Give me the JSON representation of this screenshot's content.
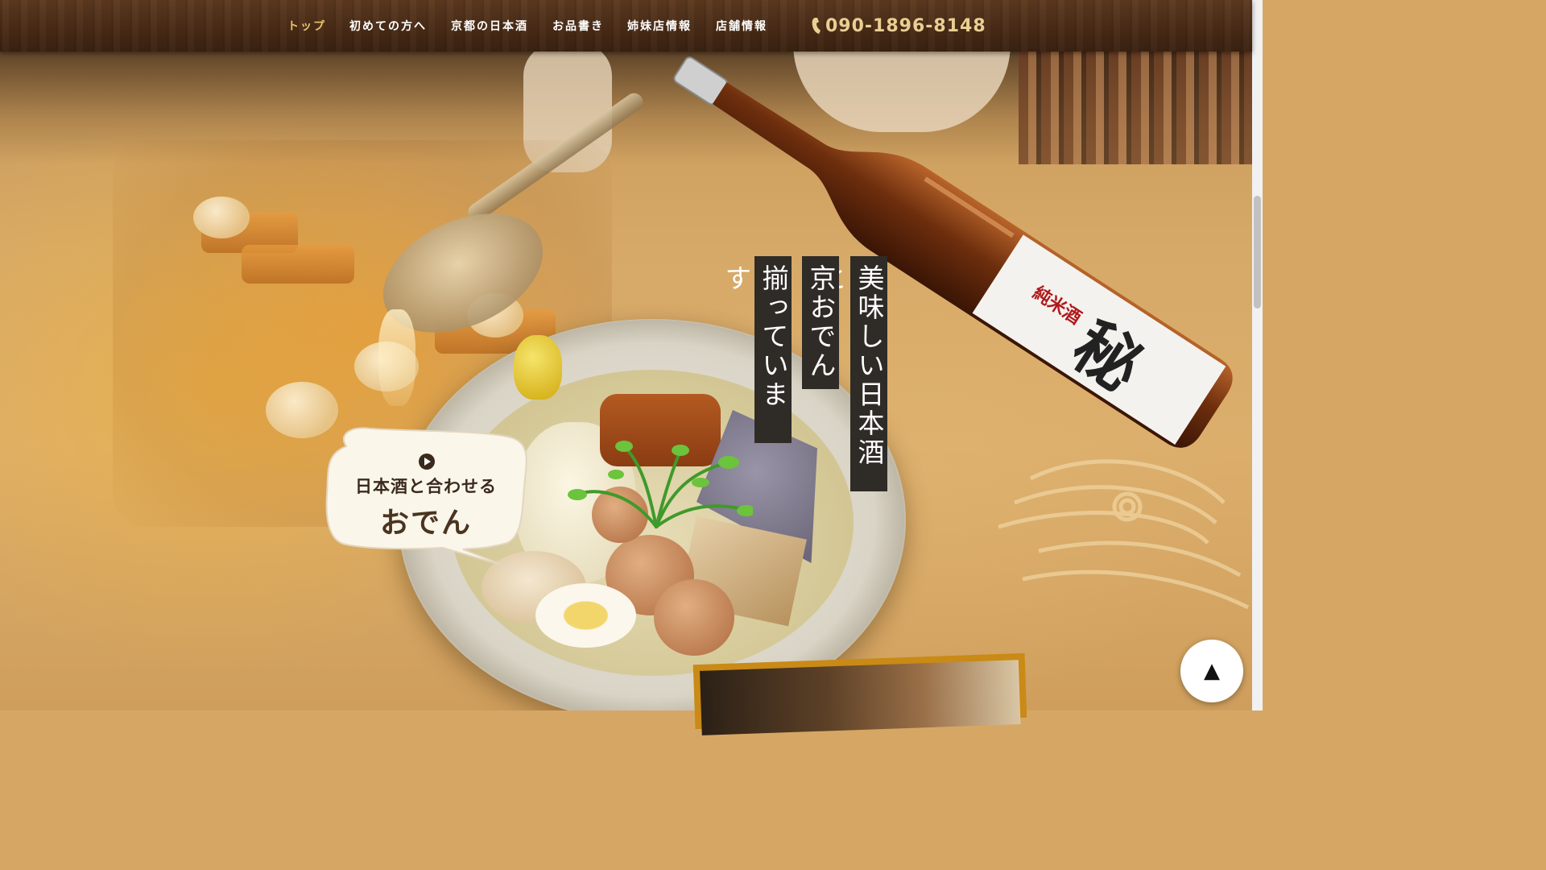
{
  "nav": {
    "items": [
      {
        "label": "トップ",
        "active": true
      },
      {
        "label": "初めての方へ",
        "active": false
      },
      {
        "label": "京都の日本酒",
        "active": false
      },
      {
        "label": "お品書き",
        "active": false
      },
      {
        "label": "姉妹店情報",
        "active": false
      },
      {
        "label": "店舗情報",
        "active": false
      }
    ],
    "phone": "090-1896-8148",
    "phone_icon": "phone-icon"
  },
  "hero": {
    "captions": [
      "美味しい日本酒と",
      "京おでん",
      "揃っています"
    ],
    "bubble": {
      "line1": "日本酒と合わせる",
      "line2": "おでん",
      "icon": "play-circle-icon"
    },
    "bottle_label": {
      "top": "純米酒",
      "brand": "秘"
    }
  },
  "back_to_top": {
    "label": "▲"
  },
  "colors": {
    "header_bg": "#4a2c17",
    "nav_active": "#e8c26a",
    "phone": "#e9cf93",
    "caption_bg": "#2f2b27",
    "accent_frame": "#c98a16"
  }
}
